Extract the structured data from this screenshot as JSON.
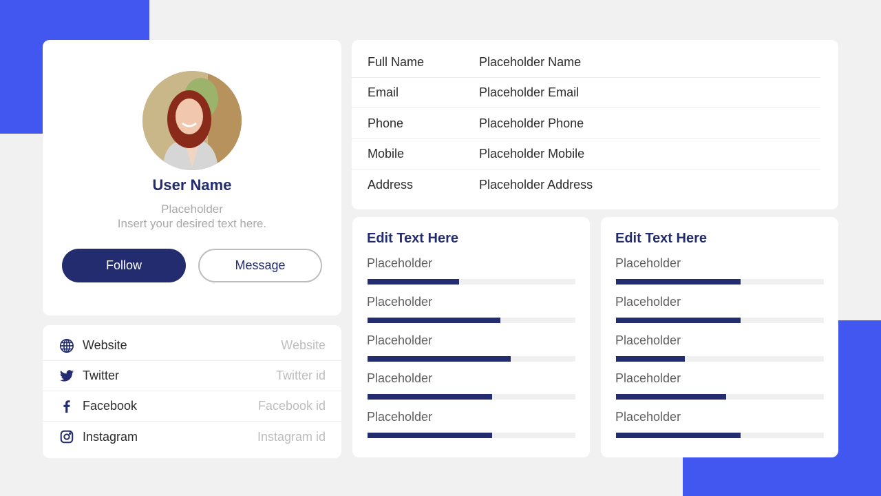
{
  "colors": {
    "accent": "#4257f0",
    "primary": "#222c6e",
    "background": "#f1f1f1",
    "track": "#f0f0f0"
  },
  "profile": {
    "name": "User Name",
    "subtitle_line1": "Placeholder",
    "subtitle_line2": "Insert your desired text here.",
    "follow_label": "Follow",
    "message_label": "Message",
    "avatar_icon": "user-photo"
  },
  "social": [
    {
      "icon": "globe-icon",
      "label": "Website",
      "value": "Website"
    },
    {
      "icon": "twitter-icon",
      "label": "Twitter",
      "value": "Twitter  id"
    },
    {
      "icon": "facebook-icon",
      "label": "Facebook",
      "value": "Facebook id"
    },
    {
      "icon": "instagram-icon",
      "label": "Instagram",
      "value": "Instagram id"
    }
  ],
  "info": [
    {
      "label": "Full Name",
      "value": "Placeholder Name"
    },
    {
      "label": "Email",
      "value": "Placeholder Email"
    },
    {
      "label": "Phone",
      "value": "Placeholder Phone"
    },
    {
      "label": "Mobile",
      "value": "Placeholder Mobile"
    },
    {
      "label": "Address",
      "value": "Placeholder Address"
    }
  ],
  "skill_cards": [
    {
      "title": "Edit Text Here",
      "items": [
        {
          "label": "Placeholder",
          "progress": 0.44
        },
        {
          "label": "Placeholder",
          "progress": 0.64
        },
        {
          "label": "Placeholder",
          "progress": 0.69
        },
        {
          "label": "Placeholder",
          "progress": 0.6
        },
        {
          "label": "Placeholder",
          "progress": 0.6
        }
      ]
    },
    {
      "title": "Edit Text Here",
      "items": [
        {
          "label": "Placeholder",
          "progress": 0.6
        },
        {
          "label": "Placeholder",
          "progress": 0.6
        },
        {
          "label": "Placeholder",
          "progress": 0.33
        },
        {
          "label": "Placeholder",
          "progress": 0.53
        },
        {
          "label": "Placeholder",
          "progress": 0.6
        }
      ]
    }
  ]
}
